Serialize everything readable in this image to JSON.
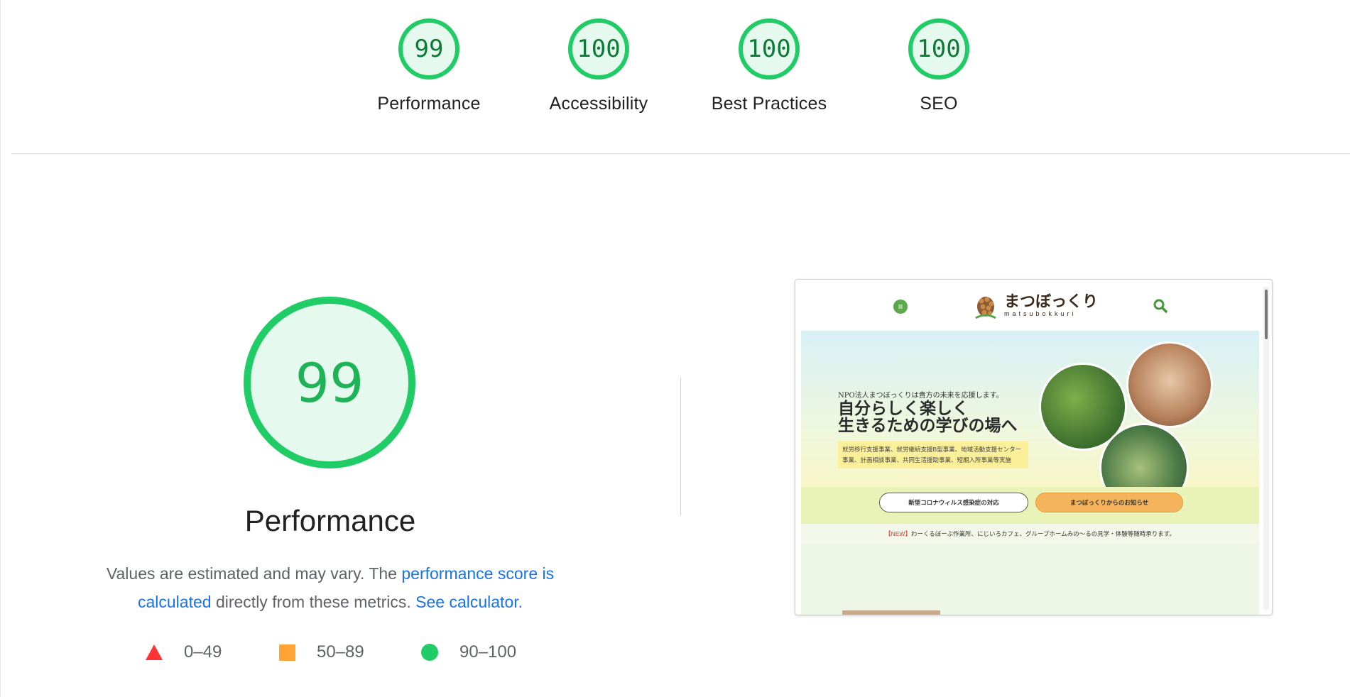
{
  "summary": [
    {
      "score": "99",
      "label": "Performance"
    },
    {
      "score": "100",
      "label": "Accessibility"
    },
    {
      "score": "100",
      "label": "Best Practices"
    },
    {
      "score": "100",
      "label": "SEO"
    }
  ],
  "main": {
    "score": "99",
    "title": "Performance",
    "desc_prefix": "Values are estimated and may vary. The ",
    "link_score": "performance score is calculated",
    "desc_mid": " directly from these metrics. ",
    "link_calc": "See calculator.",
    "legend": [
      "0–49",
      "50–89",
      "90–100"
    ]
  },
  "thumbnail": {
    "logo_jp": "まつぼっくり",
    "logo_en": "matsubokkuri",
    "lead": "NPO法人まつぼっくりは貴方の未来を応援します。",
    "headline1": "自分らしく楽しく",
    "headline2": "生きるための学びの場へ",
    "box_text": "就労移行支援事業、就労継続支援B型事業、地域活動支援センター事業、計画相談事業、共同生活援助事業、短期入所事業等実施",
    "button1": "新型コロナウィルス感染症の対応",
    "button2": "まつぼっくりからのお知らせ",
    "news_tag": "【NEW】",
    "news_text": "わーくるぼーぶ作業所、にじいろカフェ、グループホームみの～るの見学・体験等随時承ります。"
  },
  "colors": {
    "pass": "#1fcc66",
    "pass_text": "#0d7a35",
    "average": "#ffa434",
    "fail": "#ff3333",
    "link": "#1a73e8"
  }
}
